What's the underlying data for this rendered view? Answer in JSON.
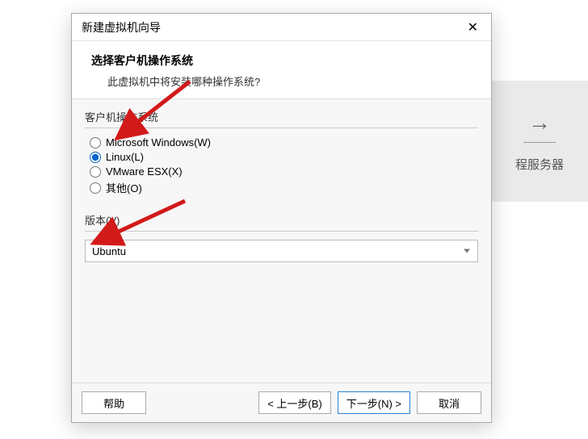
{
  "background": {
    "right_panel_text": "程服务器"
  },
  "dialog": {
    "title": "新建虚拟机向导",
    "header": {
      "title": "选择客户机操作系统",
      "subtitle": "此虚拟机中将安装哪种操作系统?"
    },
    "os_group": {
      "label": "客户机操作系统",
      "options": [
        {
          "label": "Microsoft Windows(W)",
          "value": "windows",
          "selected": false
        },
        {
          "label": "Linux(L)",
          "value": "linux",
          "selected": true
        },
        {
          "label": "VMware ESX(X)",
          "value": "esx",
          "selected": false
        },
        {
          "label": "其他(O)",
          "value": "other",
          "selected": false
        }
      ]
    },
    "version_group": {
      "label": "版本(V)",
      "selected": "Ubuntu"
    },
    "footer": {
      "help": "帮助",
      "back": "< 上一步(B)",
      "next": "下一步(N) >",
      "cancel": "取消"
    }
  },
  "colors": {
    "accent": "#0a64c8",
    "annotation": "#d21a1a"
  }
}
